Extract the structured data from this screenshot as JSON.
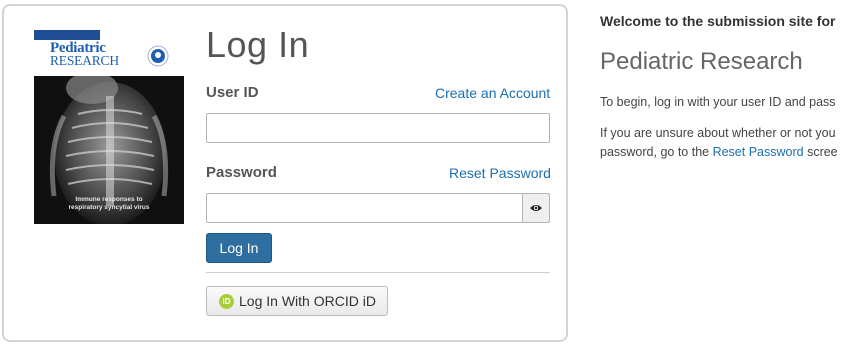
{
  "cover": {
    "journal_title_line1": "Pediatric",
    "journal_title_line2": "RESEARCH",
    "caption_line1": "Immune responses to",
    "caption_line2": "respiratory syncytial virus"
  },
  "login": {
    "title": "Log In",
    "user_id_label": "User ID",
    "create_account_link": "Create an Account",
    "user_id_value": "",
    "password_label": "Password",
    "reset_password_link": "Reset Password",
    "password_value": "",
    "login_button": "Log In",
    "orcid_button": "Log In With ORCID iD",
    "orcid_icon_text": "iD"
  },
  "info": {
    "welcome": "Welcome to the submission site for",
    "journal_name": "Pediatric Research",
    "p1": "To begin, log in with your user ID and pass",
    "p2_line1": "If you are unsure about whether or not you",
    "p2_line2_pre": "password, go to the ",
    "p2_line2_link": "Reset Password",
    "p2_line2_post": " scree"
  },
  "colors": {
    "link": "#1a6fb0",
    "primary_button": "#2f6ea0",
    "orcid_green": "#a6ce39"
  }
}
